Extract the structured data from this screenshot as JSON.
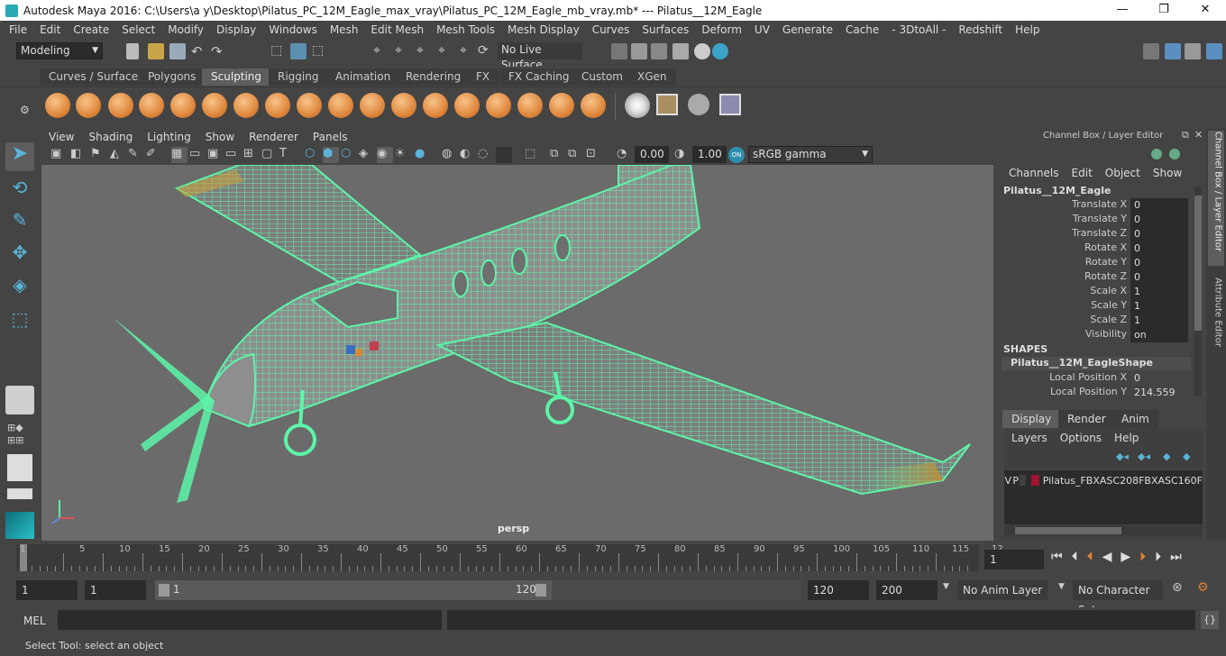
{
  "window": {
    "title": "Autodesk Maya 2016: C:\\Users\\a y\\Desktop\\Pilatus_PC_12M_Eagle_max_vray\\Pilatus_PC_12M_Eagle_mb_vray.mb*    ---    Pilatus__12M_Eagle",
    "controls": [
      "—",
      "❐",
      "✕"
    ]
  },
  "menubar": [
    "File",
    "Edit",
    "Create",
    "Select",
    "Modify",
    "Display",
    "Windows",
    "Mesh",
    "Edit Mesh",
    "Mesh Tools",
    "Mesh Display",
    "Curves",
    "Surfaces",
    "Deform",
    "UV",
    "Generate",
    "Cache",
    "- 3DtoAll -",
    "Redshift",
    "Help"
  ],
  "statusline": {
    "mode": "Modeling",
    "live_surface": "No Live Surface"
  },
  "shelf": {
    "tabs": [
      "Curves / Surfaces",
      "Polygons",
      "Sculpting",
      "Rigging",
      "Animation",
      "Rendering",
      "FX",
      "FX Caching",
      "Custom",
      "XGen"
    ],
    "active_tab": "Sculpting"
  },
  "viewport": {
    "menu": [
      "View",
      "Shading",
      "Lighting",
      "Show",
      "Renderer",
      "Panels"
    ],
    "exposure": "0.00",
    "gamma": "1.00",
    "color_space": "sRGB gamma",
    "camera_label": "persp"
  },
  "channel_box": {
    "header": "Channel Box / Layer Editor",
    "menu": [
      "Channels",
      "Edit",
      "Object",
      "Show"
    ],
    "object_name": "Pilatus__12M_Eagle",
    "attributes": [
      {
        "label": "Translate X",
        "value": "0"
      },
      {
        "label": "Translate Y",
        "value": "0"
      },
      {
        "label": "Translate Z",
        "value": "0"
      },
      {
        "label": "Rotate X",
        "value": "0"
      },
      {
        "label": "Rotate Y",
        "value": "0"
      },
      {
        "label": "Rotate Z",
        "value": "0"
      },
      {
        "label": "Scale X",
        "value": "1"
      },
      {
        "label": "Scale Y",
        "value": "1"
      },
      {
        "label": "Scale Z",
        "value": "1"
      },
      {
        "label": "Visibility",
        "value": "on"
      }
    ],
    "shapes_label": "SHAPES",
    "shape_name": "Pilatus__12M_EagleShape",
    "shape_attributes": [
      {
        "label": "Local Position X",
        "value": "0"
      },
      {
        "label": "Local Position Y",
        "value": "214.559"
      }
    ]
  },
  "layer_editor": {
    "tabs": [
      "Display",
      "Render",
      "Anim"
    ],
    "active_tab": "Display",
    "menu": [
      "Layers",
      "Options",
      "Help"
    ],
    "layer": {
      "v": "V",
      "p": "P",
      "name": "Pilatus_FBXASC208FBXASC160F",
      "color": "#a01530"
    }
  },
  "side_tabs": [
    "Channel Box / Layer Editor",
    "Attribute Editor"
  ],
  "timeline": {
    "ticks": [
      "1",
      "5",
      "10",
      "15",
      "20",
      "25",
      "30",
      "35",
      "40",
      "45",
      "50",
      "55",
      "60",
      "65",
      "70",
      "75",
      "80",
      "85",
      "90",
      "95",
      "100",
      "105",
      "110",
      "115",
      "12"
    ],
    "current_frame": "1"
  },
  "range": {
    "start": "1",
    "playback_start": "1",
    "slider_start": "1",
    "slider_end": "120",
    "playback_end": "120",
    "end": "200",
    "anim_layer": "No Anim Layer",
    "character_set": "No Character Set"
  },
  "command_line": {
    "label": "MEL"
  },
  "help_line": "Select Tool: select an object",
  "colors": {
    "wire": "#5cf5a8",
    "accent": "#5ab4d8",
    "bg": "#444444",
    "viewport": "#6b6b6b"
  }
}
